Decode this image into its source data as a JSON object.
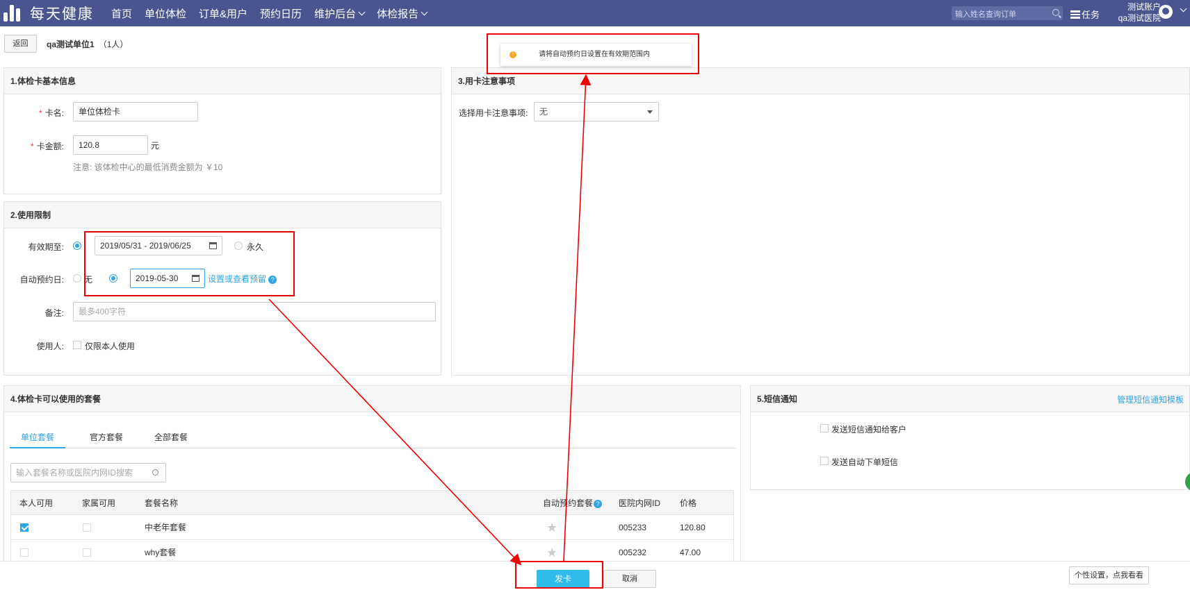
{
  "header": {
    "logo_text": "每天健康",
    "nav": [
      "首页",
      "单位体检",
      "订单&用户",
      "预约日历",
      "维护后台",
      "体检报告"
    ],
    "search_placeholder": "输入姓名查询订单",
    "task_label": "任务",
    "account": "测试账户",
    "hospital": "qa测试医院"
  },
  "page": {
    "back_label": "返回",
    "title": "qa测试单位1",
    "count": "（1人）"
  },
  "toast": {
    "icon": "!",
    "message": "请将自动预约日设置在有效期范围内"
  },
  "section1": {
    "title": "1.体检卡基本信息",
    "required_mark": "*",
    "card_name_label": "卡名:",
    "card_name_value": "单位体检卡",
    "amount_label": "卡金额:",
    "amount_value": "120.8",
    "amount_unit": "元",
    "note": "注意: 该体检中心的最低消费金额为 ￥10"
  },
  "section2": {
    "title": "2.使用限制",
    "validity_label": "有效期至:",
    "validity_value": "2019/05/31 - 2019/06/25",
    "forever_label": "永久",
    "auto_label": "自动预约日:",
    "auto_none_label": "无",
    "auto_date_value": "2019-05-30",
    "auto_link": "设置或查看预留",
    "help_icon": "?",
    "remark_label": "备注:",
    "remark_placeholder": "最多400字符",
    "user_label": "使用人:",
    "self_only_label": "仅限本人使用"
  },
  "section3": {
    "title": "3.用卡注意事项",
    "select_label": "选择用卡注意事项:",
    "select_value": "无"
  },
  "section4": {
    "title": "4.体检卡可以使用的套餐",
    "tabs": [
      "单位套餐",
      "官方套餐",
      "全部套餐"
    ],
    "search_placeholder": "输入套餐名称或医院内网ID搜索",
    "columns": [
      "本人可用",
      "家属可用",
      "套餐名称",
      "自动预约套餐",
      "医院内网ID",
      "价格"
    ],
    "rows": [
      {
        "name": "中老年套餐",
        "id": "005233",
        "price": "120.80",
        "self": true
      },
      {
        "name": "why套餐",
        "id": "005232",
        "price": "47.00",
        "self": false
      }
    ],
    "star_glyph": "★"
  },
  "section5": {
    "title": "5.短信通知",
    "manage_link": "管理短信通知模板",
    "opt1": "发送短信通知给客户",
    "opt2": "发送自动下单短信"
  },
  "footer": {
    "submit_label": "发卡",
    "cancel_label": "取消"
  },
  "tip": {
    "text": "个性设置，点我看看"
  },
  "colors": {
    "topbar": "#4a5490",
    "accent": "#2fa4e7",
    "annotation": "#e00000",
    "warning": "#f5a623"
  }
}
